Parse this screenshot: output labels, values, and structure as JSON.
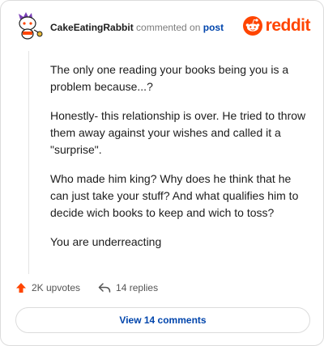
{
  "header": {
    "username": "CakeEatingRabbit",
    "action_text": "commented on",
    "post_link": "post",
    "logo_text": "reddit",
    "avatar_icon": "snoo-avatar-icon",
    "logo_icon": "reddit-alien-icon",
    "brand_color": "#ff4500"
  },
  "comment": {
    "paragraphs": [
      "The only one reading your books being you is a problem because...?",
      "Honestly- this relationship is over. He tried to throw them away against your wishes and called it a \"surprise\".",
      "Who made him king? Why does he think that he can just take your stuff? And what qualifies him to decide wich books to keep and wich to toss?",
      "You are underreacting"
    ]
  },
  "footer": {
    "upvotes": "2K upvotes",
    "replies": "14 replies",
    "upvote_icon": "upvote-arrow-icon",
    "reply_icon": "reply-arrow-icon"
  },
  "view_comments_label": "View 14 comments"
}
